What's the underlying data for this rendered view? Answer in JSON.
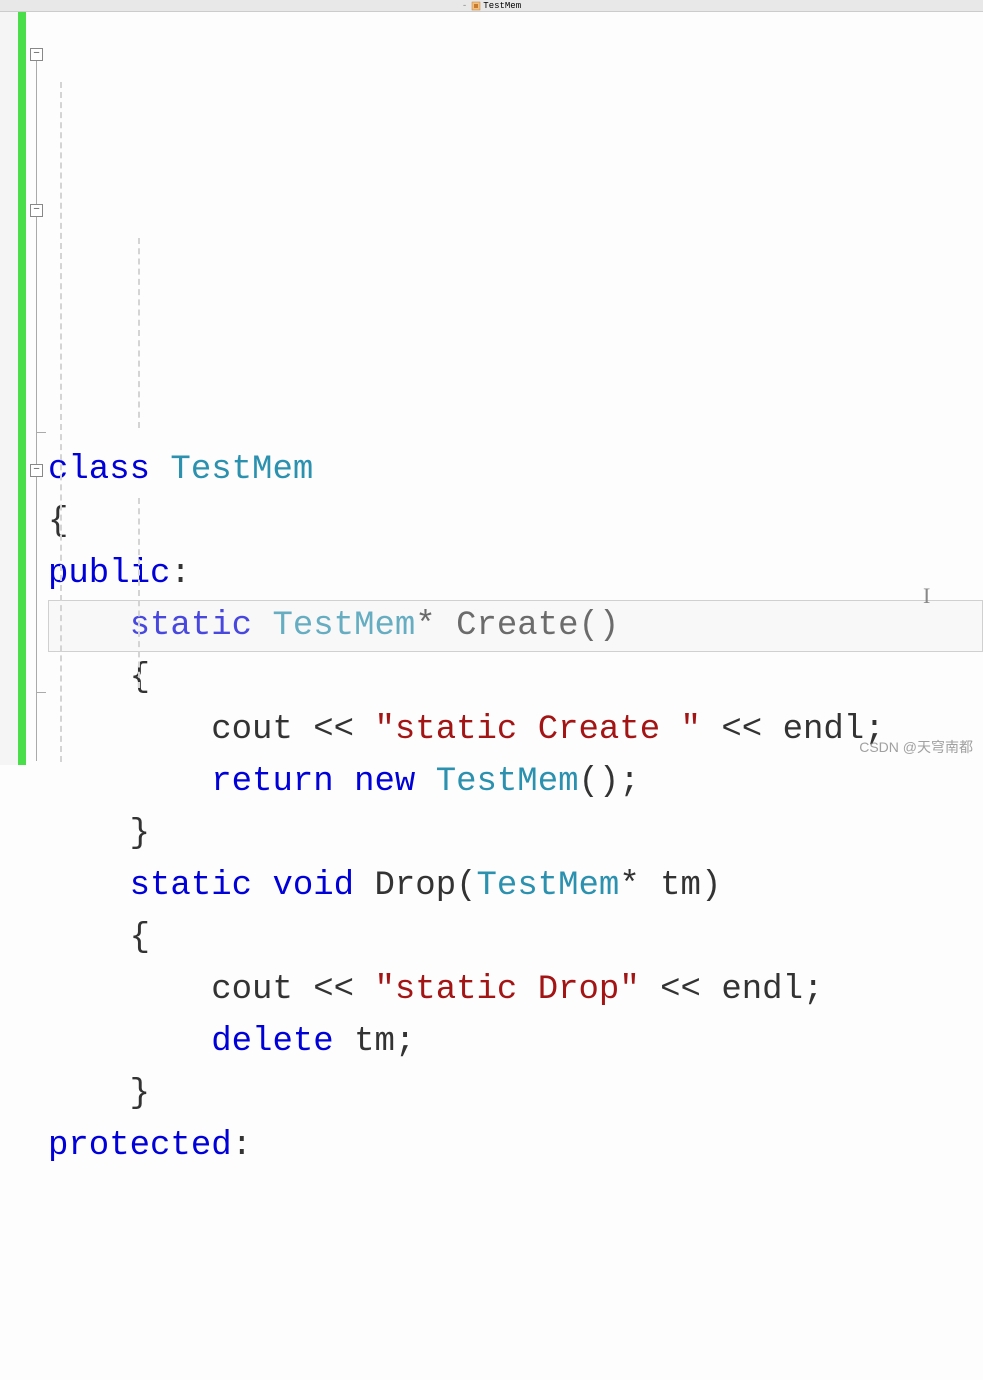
{
  "nav": {
    "class_name": "TestMem"
  },
  "code": {
    "lines": [
      {
        "tokens": [
          {
            "t": "kw",
            "v": "class "
          },
          {
            "t": "type",
            "v": "TestMem"
          }
        ]
      },
      {
        "tokens": [
          {
            "t": "punct",
            "v": "{"
          }
        ]
      },
      {
        "tokens": [
          {
            "t": "kw",
            "v": "public"
          },
          {
            "t": "punct",
            "v": ":"
          }
        ]
      },
      {
        "tokens": [
          {
            "t": "sp",
            "v": "    "
          },
          {
            "t": "kw",
            "v": "static "
          },
          {
            "t": "type",
            "v": "TestMem"
          },
          {
            "t": "op",
            "v": "* "
          },
          {
            "t": "ident",
            "v": "Create"
          },
          {
            "t": "punct",
            "v": "()"
          }
        ]
      },
      {
        "tokens": [
          {
            "t": "sp",
            "v": "    "
          },
          {
            "t": "punct",
            "v": "{"
          }
        ]
      },
      {
        "tokens": [
          {
            "t": "sp",
            "v": "        "
          },
          {
            "t": "ident",
            "v": "cout "
          },
          {
            "t": "op",
            "v": "<< "
          },
          {
            "t": "str",
            "v": "\"static Create \""
          },
          {
            "t": "op",
            "v": " << "
          },
          {
            "t": "ident",
            "v": "endl"
          },
          {
            "t": "punct",
            "v": ";"
          }
        ]
      },
      {
        "tokens": [
          {
            "t": "sp",
            "v": "        "
          },
          {
            "t": "kw",
            "v": "return "
          },
          {
            "t": "kw",
            "v": "new "
          },
          {
            "t": "type",
            "v": "TestMem"
          },
          {
            "t": "punct",
            "v": "();"
          }
        ]
      },
      {
        "tokens": [
          {
            "t": "sp",
            "v": "    "
          },
          {
            "t": "punct",
            "v": "}"
          }
        ]
      },
      {
        "tokens": [
          {
            "t": "sp",
            "v": "    "
          },
          {
            "t": "kw",
            "v": "static "
          },
          {
            "t": "kw",
            "v": "void "
          },
          {
            "t": "ident",
            "v": "Drop"
          },
          {
            "t": "punct",
            "v": "("
          },
          {
            "t": "type",
            "v": "TestMem"
          },
          {
            "t": "op",
            "v": "* "
          },
          {
            "t": "ident",
            "v": "tm"
          },
          {
            "t": "punct",
            "v": ")"
          }
        ]
      },
      {
        "tokens": [
          {
            "t": "sp",
            "v": "    "
          },
          {
            "t": "punct",
            "v": "{"
          }
        ]
      },
      {
        "tokens": [
          {
            "t": "sp",
            "v": "        "
          },
          {
            "t": "ident",
            "v": "cout "
          },
          {
            "t": "op",
            "v": "<< "
          },
          {
            "t": "str",
            "v": "\"static Drop\""
          },
          {
            "t": "op",
            "v": " << "
          },
          {
            "t": "ident",
            "v": "endl"
          },
          {
            "t": "punct",
            "v": ";"
          }
        ]
      },
      {
        "tokens": [
          {
            "t": "sp",
            "v": "        "
          },
          {
            "t": "kw",
            "v": "delete "
          },
          {
            "t": "ident",
            "v": "tm"
          },
          {
            "t": "punct",
            "v": ";"
          }
        ]
      },
      {
        "tokens": [
          {
            "t": "sp",
            "v": "    "
          },
          {
            "t": "punct",
            "v": "}"
          }
        ]
      },
      {
        "tokens": [
          {
            "t": "kw",
            "v": "protected"
          },
          {
            "t": "punct",
            "v": ":"
          }
        ]
      }
    ]
  },
  "watermark": "CSDN @天穹南都"
}
